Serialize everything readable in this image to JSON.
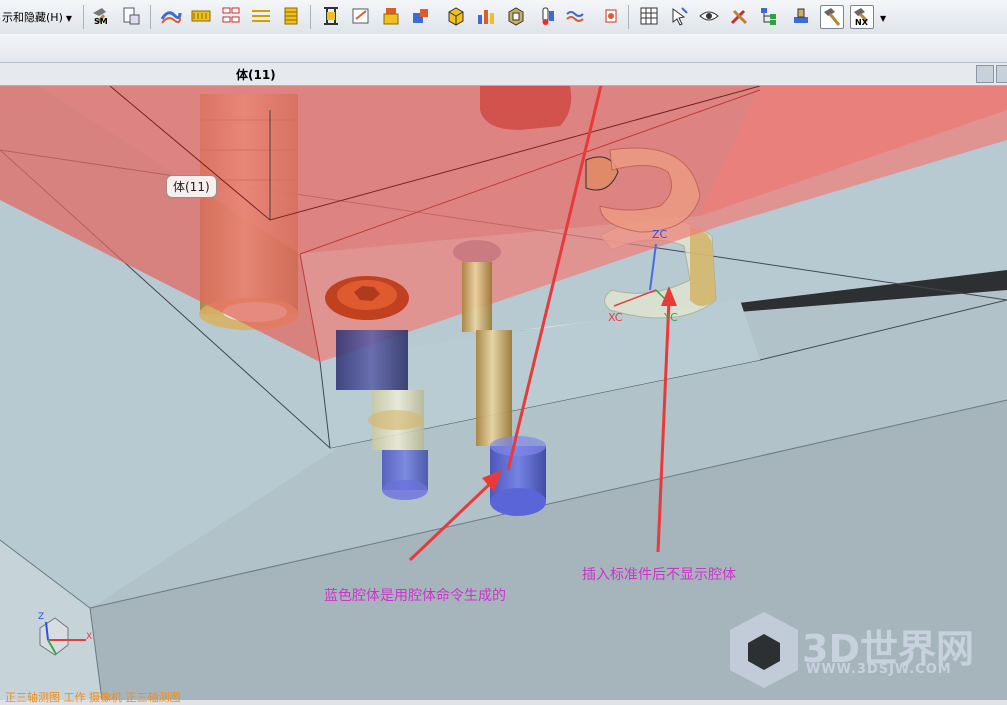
{
  "toolbar": {
    "menu_label": "示和隐藏(H)",
    "sm_label": "SM",
    "nx_label": "NX"
  },
  "tab": {
    "title": "体(11)"
  },
  "viewport": {
    "tooltip": "体(11)",
    "axis_zc": "ZC",
    "axis_xc": "XC",
    "axis_yc": "YC",
    "triad_z": "Z",
    "triad_x": "X"
  },
  "annotations": {
    "left": "蓝色腔体是用腔体命令生成的",
    "right": "插入标准件后不显示腔体"
  },
  "status_bar": {
    "text": "正三轴测图  工作  摄像机  正三轴测图"
  },
  "watermark": {
    "brand": "3D世界网",
    "url": "WWW.3DSJW.COM"
  },
  "colors": {
    "plate_red": "#e8706b",
    "cavity_blue": "#5a68d8",
    "annotation_magenta": "#cc33cc",
    "arrow_red": "#e83a3a"
  },
  "icons": [
    "sm-hammer-icon",
    "page-icon",
    "surface-icon",
    "pattern-icon",
    "grid-icon",
    "mesh-icon",
    "column-icon",
    "bracket-icon",
    "edit-icon",
    "stack-icon",
    "add-icon",
    "cube-icon",
    "chart-icon",
    "solid-icon",
    "thermo-icon",
    "wave-icon",
    "robot-icon",
    "table-icon",
    "cursor-icon",
    "eye-icon",
    "tools-icon",
    "tree-icon",
    "stamp-icon",
    "hammer-icon",
    "nx-hammer-icon"
  ]
}
